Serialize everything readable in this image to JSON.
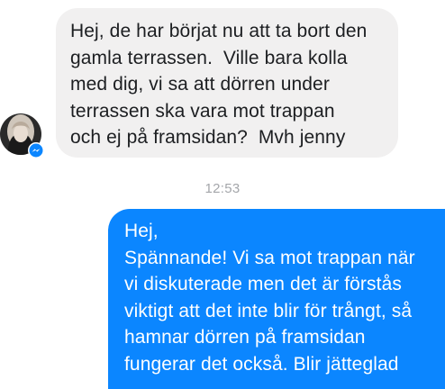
{
  "conversation": {
    "incoming": {
      "lines": [
        "Hej, de har börjat nu att ta bort den",
        "gamla terrassen.  Ville bara kolla",
        "med dig, vi sa att dörren under",
        "terrassen ska vara mot trappan",
        "och ej på framsidan?  Mvh jenny"
      ],
      "avatar_icon": "contact-photo-icon",
      "badge_icon": "messenger-logo-icon"
    },
    "timestamp": "12:53",
    "outgoing": {
      "lines": [
        "Hej,",
        "Spännande! Vi sa mot trappan när",
        "vi diskuterade men det är förstås",
        "viktigt att det inte blir för trångt, så",
        "hamnar dörren på framsidan",
        "fungerar det också. Blir jätteglad"
      ]
    }
  },
  "colors": {
    "incoming_bubble": "#f1f0f0",
    "incoming_text": "#1c1e21",
    "outgoing_bubble": "#0b86ff",
    "outgoing_text": "#ffffff",
    "timestamp_text": "#a4a6aa",
    "badge": "#0b86ff"
  }
}
